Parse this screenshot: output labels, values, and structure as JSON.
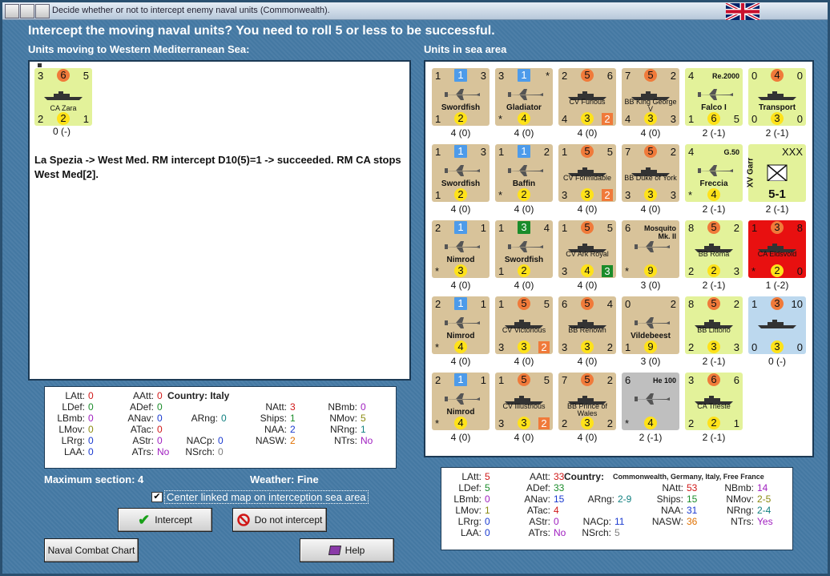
{
  "window": {
    "title": "Decide whether or not to intercept enemy naval units (Commonwealth)."
  },
  "heading": "Intercept the moving naval units?  You need to roll 5 or less to be successful.",
  "moving": {
    "header": "Units moving to Western Mediterranean Sea:",
    "unit": {
      "tl": "3",
      "tc": "6",
      "tr": "5",
      "name": "CA Zara",
      "bl": "2",
      "bc": "2",
      "br": "1",
      "order": "0 (-)"
    },
    "log": "La Spezia -> West Med.  RM intercept D10(5)=1 -> succeeded.  RM CA stops West Med[2]."
  },
  "sea": {
    "header": "Units in sea area",
    "units": [
      {
        "style": "tan",
        "tl": "1",
        "tc": "1",
        "tcs": "sq-blue",
        "tr": "3",
        "name": "Swordfish",
        "bold": true,
        "bl": "1",
        "bc": "2",
        "br": "",
        "pic": "plane",
        "order": "4 (0)"
      },
      {
        "style": "tan",
        "tl": "3",
        "tc": "1",
        "tcs": "sq-blue",
        "tr": "*",
        "name": "Gladiator",
        "bold": true,
        "bl": "*",
        "bc": "4",
        "br": "",
        "pic": "plane",
        "order": "4 (0)"
      },
      {
        "style": "tan",
        "tl": "2",
        "tc": "5",
        "tcs": "c-or",
        "tr": "6",
        "name": "CV Furious",
        "bold": false,
        "bl": "4",
        "bc": "3",
        "br": "2",
        "pic": "ship",
        "order": "4 (0)"
      },
      {
        "style": "tan",
        "tl": "7",
        "tc": "5",
        "tcs": "c-or",
        "tr": "2",
        "name": "BB King George V",
        "bold": false,
        "bl": "4",
        "bc": "3",
        "br": "3",
        "pic": "ship",
        "order": "4 (0)"
      },
      {
        "style": "yel",
        "tl": "4",
        "tc": "",
        "tcs": "",
        "tr": "Re.2000",
        "name": "Falco I",
        "bold": true,
        "bl": "1",
        "bc": "6",
        "br": "5",
        "pic": "plane",
        "order": "2 (-1)"
      },
      {
        "style": "yel",
        "tl": "0",
        "tc": "4",
        "tcs": "c-or",
        "tr": "0",
        "name": "Transport",
        "bold": true,
        "bl": "0",
        "bc": "3",
        "br": "0",
        "pic": "ship",
        "order": "2 (-1)"
      },
      {
        "style": "tan",
        "tl": "1",
        "tc": "1",
        "tcs": "sq-blue",
        "tr": "3",
        "name": "Swordfish",
        "bold": true,
        "bl": "1",
        "bc": "2",
        "br": "",
        "pic": "plane",
        "order": "4 (0)"
      },
      {
        "style": "tan",
        "tl": "1",
        "tc": "1",
        "tcs": "sq-blue",
        "tr": "2",
        "name": "Baffin",
        "bold": true,
        "bl": "*",
        "bc": "2",
        "br": "",
        "pic": "plane",
        "order": "4 (0)"
      },
      {
        "style": "tan",
        "tl": "1",
        "tc": "5",
        "tcs": "c-or",
        "tr": "5",
        "name": "CV Formidable",
        "bold": false,
        "bl": "3",
        "bc": "3",
        "br": "2",
        "pic": "ship",
        "order": "4 (0)"
      },
      {
        "style": "tan",
        "tl": "7",
        "tc": "5",
        "tcs": "c-or",
        "tr": "2",
        "name": "BB Duke of York",
        "bold": false,
        "bl": "3",
        "bc": "3",
        "br": "3",
        "pic": "ship",
        "order": "4 (0)"
      },
      {
        "style": "yel",
        "tl": "4",
        "tc": "",
        "tcs": "",
        "tr": "G.50",
        "name": "Freccia",
        "bold": true,
        "bl": "*",
        "bc": "4",
        "br": "",
        "pic": "plane",
        "order": "2 (-1)"
      },
      {
        "style": "yel",
        "tl": "",
        "tc": "",
        "tcs": "",
        "tr": "XXX",
        "name": "XV Garr",
        "bold": true,
        "bl": "",
        "bc": "5-1",
        "br": "",
        "pic": "garr",
        "order": "2 (-1)"
      },
      {
        "style": "tan",
        "tl": "2",
        "tc": "1",
        "tcs": "sq-blue",
        "tr": "1",
        "name": "Nimrod",
        "bold": true,
        "bl": "*",
        "bc": "3",
        "br": "",
        "pic": "plane",
        "order": "4 (0)"
      },
      {
        "style": "tan",
        "tl": "1",
        "tc": "3",
        "tcs": "sq-green",
        "tr": "4",
        "name": "Swordfish",
        "bold": true,
        "bl": "1",
        "bc": "2",
        "br": "",
        "pic": "plane",
        "order": "4 (0)"
      },
      {
        "style": "tan",
        "tl": "1",
        "tc": "5",
        "tcs": "c-or",
        "tr": "5",
        "name": "CV Ark Royal",
        "bold": false,
        "bl": "3",
        "bc": "4",
        "br": "3",
        "pic": "ship",
        "order": "4 (0)"
      },
      {
        "style": "tan",
        "tl": "6",
        "tc": "",
        "tcs": "",
        "tr": "Mosquito Mk. II",
        "name": "",
        "bold": true,
        "bl": "*",
        "bc": "9",
        "br": "",
        "pic": "plane",
        "order": "3 (0)"
      },
      {
        "style": "yel",
        "tl": "8",
        "tc": "5",
        "tcs": "c-or",
        "tr": "2",
        "name": "BB Roma",
        "bold": false,
        "bl": "2",
        "bc": "2",
        "br": "3",
        "pic": "ship",
        "order": "2 (-1)"
      },
      {
        "style": "red",
        "tl": "1",
        "tc": "3",
        "tcs": "c-or",
        "tr": "8",
        "name": "CA Eldsvold",
        "bold": false,
        "bl": "*",
        "bc": "2",
        "br": "0",
        "pic": "ship",
        "order": "1 (-2)"
      },
      {
        "style": "tan",
        "tl": "2",
        "tc": "1",
        "tcs": "sq-blue",
        "tr": "1",
        "name": "Nimrod",
        "bold": true,
        "bl": "*",
        "bc": "4",
        "br": "",
        "pic": "plane",
        "order": "4 (0)"
      },
      {
        "style": "tan",
        "tl": "1",
        "tc": "5",
        "tcs": "c-or",
        "tr": "5",
        "name": "CV Victorious",
        "bold": false,
        "bl": "3",
        "bc": "3",
        "br": "2",
        "pic": "ship",
        "order": "4 (0)"
      },
      {
        "style": "tan",
        "tl": "6",
        "tc": "5",
        "tcs": "c-or",
        "tr": "4",
        "name": "BB Renown",
        "bold": false,
        "bl": "3",
        "bc": "3",
        "br": "2",
        "pic": "ship",
        "order": "4 (0)"
      },
      {
        "style": "tan",
        "tl": "0",
        "tc": "",
        "tcs": "",
        "tr": "2",
        "name": "Vildebeest",
        "bold": true,
        "bl": "1",
        "bc": "9",
        "br": "",
        "pic": "plane",
        "order": "3 (0)"
      },
      {
        "style": "yel",
        "tl": "8",
        "tc": "5",
        "tcs": "c-or",
        "tr": "2",
        "name": "BB Littorio",
        "bold": false,
        "bl": "2",
        "bc": "3",
        "br": "3",
        "pic": "ship",
        "order": "2 (-1)"
      },
      {
        "style": "blu",
        "tl": "1",
        "tc": "3",
        "tcs": "c-or",
        "tr": "10",
        "name": "",
        "bold": false,
        "bl": "0",
        "bc": "3",
        "br": "0",
        "pic": "ship",
        "order": "0 (-)"
      },
      {
        "style": "tan",
        "tl": "2",
        "tc": "1",
        "tcs": "sq-blue",
        "tr": "1",
        "name": "Nimrod",
        "bold": true,
        "bl": "*",
        "bc": "4",
        "br": "",
        "pic": "plane",
        "order": "4 (0)"
      },
      {
        "style": "tan",
        "tl": "1",
        "tc": "5",
        "tcs": "c-or",
        "tr": "5",
        "name": "CV Illustrious",
        "bold": false,
        "bl": "3",
        "bc": "3",
        "br": "2",
        "pic": "ship",
        "order": "4 (0)"
      },
      {
        "style": "tan",
        "tl": "7",
        "tc": "5",
        "tcs": "c-or",
        "tr": "2",
        "name": "BB Prince of Wales",
        "bold": false,
        "bl": "2",
        "bc": "3",
        "br": "2",
        "pic": "ship",
        "order": "4 (0)"
      },
      {
        "style": "gry",
        "tl": "6",
        "tc": "",
        "tcs": "",
        "tr": "He 100",
        "name": "",
        "bold": true,
        "bl": "*",
        "bc": "4",
        "br": "",
        "pic": "plane",
        "order": "2 (-1)"
      },
      {
        "style": "yel",
        "tl": "3",
        "tc": "6",
        "tcs": "c-or",
        "tr": "6",
        "name": "CA Trieste",
        "bold": false,
        "bl": "2",
        "bc": "2",
        "br": "1",
        "pic": "ship",
        "order": "2 (-1)"
      }
    ]
  },
  "left_stats": {
    "country_label": "Country: Italy",
    "items": [
      [
        "LAtt:",
        "0",
        "v-red"
      ],
      [
        "LDef:",
        "0",
        "v-grn"
      ],
      [
        "LBmb:",
        "0",
        "v-pur"
      ],
      [
        "LMov:",
        "0",
        "v-oli"
      ],
      [
        "LRrg:",
        "0",
        "v-blu"
      ],
      [
        "LAA:",
        "0",
        "v-blu"
      ],
      [
        "AAtt:",
        "0",
        "v-red"
      ],
      [
        "ADef:",
        "0",
        "v-grn"
      ],
      [
        "ANav:",
        "0",
        "v-blu"
      ],
      [
        "ATac:",
        "0",
        "v-red"
      ],
      [
        "AStr:",
        "0",
        "v-pur"
      ],
      [
        "ATrs:",
        "No",
        "v-pur"
      ],
      [
        "ARng:",
        "0",
        "v-cyn"
      ],
      [
        "NAtt:",
        "3",
        "v-red"
      ],
      [
        "Ships:",
        "1",
        "v-grn"
      ],
      [
        "NAA:",
        "2",
        "v-blu"
      ],
      [
        "NASW:",
        "2",
        "v-org"
      ],
      [
        "NBmb:",
        "0",
        "v-pur"
      ],
      [
        "NMov:",
        "5",
        "v-oli"
      ],
      [
        "NRng:",
        "1",
        "v-cyn"
      ],
      [
        "NTrs:",
        "No",
        "v-pur"
      ],
      [
        "NACp:",
        "0",
        "v-blu"
      ],
      [
        "NSrch:",
        "0",
        "v-gry"
      ]
    ]
  },
  "right_stats": {
    "country_label": "Country:",
    "country_value": "Commonwealth, Germany, Italy, Free France",
    "items": [
      [
        "LAtt:",
        "5",
        "v-red"
      ],
      [
        "LDef:",
        "5",
        "v-grn"
      ],
      [
        "LBmb:",
        "0",
        "v-pur"
      ],
      [
        "LMov:",
        "1",
        "v-oli"
      ],
      [
        "LRrg:",
        "0",
        "v-blu"
      ],
      [
        "LAA:",
        "0",
        "v-blu"
      ],
      [
        "AAtt:",
        "33",
        "v-red"
      ],
      [
        "ADef:",
        "33",
        "v-grn"
      ],
      [
        "ANav:",
        "15",
        "v-blu"
      ],
      [
        "ATac:",
        "4",
        "v-red"
      ],
      [
        "AStr:",
        "0",
        "v-pur"
      ],
      [
        "ATrs:",
        "No",
        "v-pur"
      ],
      [
        "ARng:",
        "2-9",
        "v-cyn"
      ],
      [
        "NAtt:",
        "53",
        "v-red"
      ],
      [
        "Ships:",
        "15",
        "v-grn"
      ],
      [
        "NAA:",
        "31",
        "v-blu"
      ],
      [
        "NASW:",
        "36",
        "v-org"
      ],
      [
        "NBmb:",
        "14",
        "v-pur"
      ],
      [
        "NMov:",
        "2-5",
        "v-oli"
      ],
      [
        "NRng:",
        "2-4",
        "v-cyn"
      ],
      [
        "NTrs:",
        "Yes",
        "v-pur"
      ],
      [
        "NACp:",
        "11",
        "v-blu"
      ],
      [
        "NSrch:",
        "5",
        "v-gry"
      ]
    ]
  },
  "maxsection": "Maximum section: 4",
  "weather": "Weather:  Fine",
  "center_check": "Center linked map on interception sea area",
  "buttons": {
    "intercept": "Intercept",
    "nointercept": "Do not intercept",
    "chart": "Naval Combat Chart",
    "help": "Help"
  }
}
